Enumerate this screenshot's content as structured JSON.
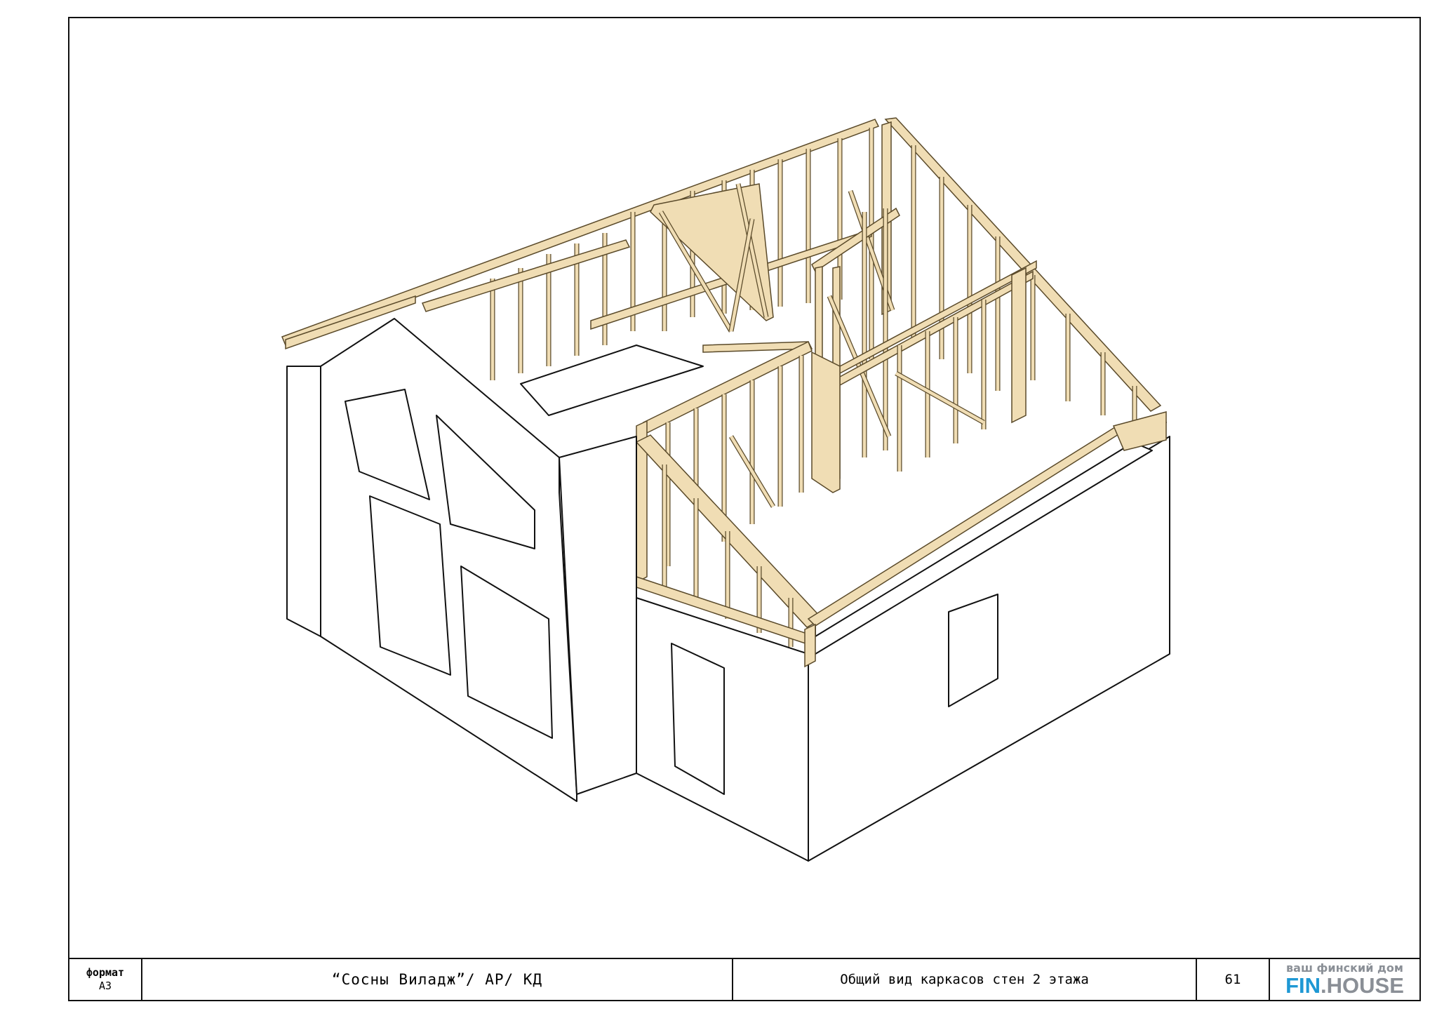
{
  "title_block": {
    "format_label": "формат",
    "format_value": "А3",
    "project": "“Сосны Виладж”/ АР/ КД",
    "sheet_title": "Общий вид каркасов стен 2 этажа",
    "page_number": "61",
    "logo_tagline": "ваш финский дом",
    "logo_fin": "FIN",
    "logo_dot": ".",
    "logo_house": "HOUSE"
  },
  "colors": {
    "frame_timber": "#f0ddb4",
    "frame_edge": "#5a4a2a",
    "wall": "#ffffff",
    "line": "#111111",
    "logo_blue": "#1e98d4",
    "logo_grey": "#8a8f96"
  }
}
